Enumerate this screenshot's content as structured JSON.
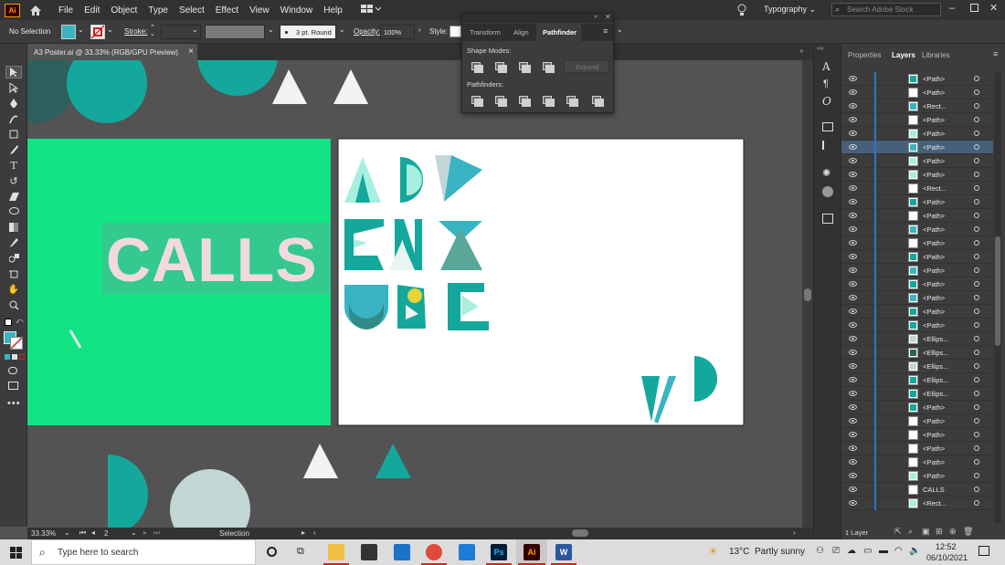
{
  "app": {
    "logo": "Ai",
    "home_icon": "home-icon"
  },
  "menu": [
    "File",
    "Edit",
    "Object",
    "Type",
    "Select",
    "Effect",
    "View",
    "Window",
    "Help"
  ],
  "menubar_right": {
    "workspace": "Typography",
    "search_placeholder": "Search Adobe Stock"
  },
  "control_bar": {
    "selection": "No Selection",
    "stroke_label": "Stroke:",
    "brush": "3 pt. Round",
    "opacity_label": "Opacity:",
    "opacity_value": "100%",
    "style_label": "Style:",
    "fill_color": "#3ab3c3"
  },
  "document": {
    "tab_title": "A3 Poster.ai @ 33.33% (RGB/GPU Preview)",
    "close": "×"
  },
  "artboard": {
    "calls_text": "CALLS",
    "green": "#12e383",
    "teal": "#14a89c",
    "pink_text": "#f1d9df"
  },
  "pathfinder": {
    "tabs": [
      "Transform",
      "Align",
      "Pathfinder"
    ],
    "active_tab": "Pathfinder",
    "shape_modes_label": "Shape Modes:",
    "expand_label": "Expand",
    "pathfinders_label": "Pathfinders:"
  },
  "status_bar": {
    "zoom": "33.33%",
    "artboard_num": "2",
    "tool": "Selection"
  },
  "right_panel": {
    "tabs": [
      "Properties",
      "Layers",
      "Libraries"
    ],
    "active_tab": "Layers",
    "layer_count": "1 Layer",
    "layers": [
      "<Path>",
      "<Path>",
      "<Rect...",
      "<Path>",
      "<Path>",
      "<Path>",
      "<Path>",
      "<Path>",
      "<Rect...",
      "<Path>",
      "<Path>",
      "<Path>",
      "<Path>",
      "<Path>",
      "<Path>",
      "<Path>",
      "<Path>",
      "<Path>",
      "<Path>",
      "<Ellips...",
      "<Ellips...",
      "<Ellips...",
      "<Ellips...",
      "<Ellips...",
      "<Path>",
      "<Path>",
      "<Path>",
      "<Path>",
      "<Path>",
      "<Path>",
      "CALLS",
      "<Rect..."
    ],
    "selected_index": 5
  },
  "taskbar": {
    "search_placeholder": "Type here to search",
    "weather_temp": "13°C",
    "weather_text": "Partly sunny",
    "time": "12:52",
    "date": "06/10/2021"
  }
}
